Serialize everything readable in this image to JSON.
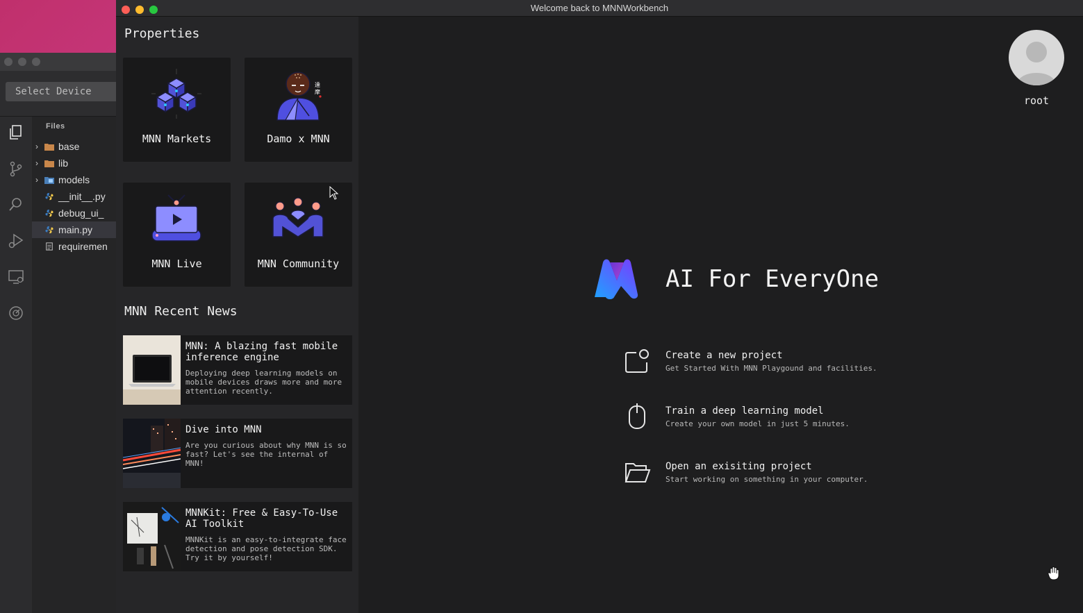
{
  "window": {
    "title": "Welcome back to MNNWorkbench"
  },
  "back_window": {
    "select_device": "Select Device",
    "files_title": "Files",
    "files": [
      {
        "name": "base",
        "type": "folder"
      },
      {
        "name": "lib",
        "type": "folder"
      },
      {
        "name": "models",
        "type": "folder"
      },
      {
        "name": "__init__.py",
        "type": "python"
      },
      {
        "name": "debug_ui_",
        "type": "python"
      },
      {
        "name": "main.py",
        "type": "python",
        "selected": true
      },
      {
        "name": "requiremen",
        "type": "text"
      }
    ]
  },
  "properties": {
    "title": "Properties",
    "cards": [
      {
        "label": "MNN Markets",
        "icon": "cubes-icon"
      },
      {
        "label": "Damo x MNN",
        "icon": "monk-icon"
      },
      {
        "label": "MNN Live",
        "icon": "tv-play-icon"
      },
      {
        "label": "MNN Community",
        "icon": "community-icon"
      }
    ]
  },
  "news": {
    "title": "MNN Recent News",
    "items": [
      {
        "title": "MNN: A blazing fast mobile inference engine",
        "desc": "Deploying deep learning models on mobile devices draws more and more attention recently."
      },
      {
        "title": "Dive into MNN",
        "desc": "Are you curious about why MNN is so fast? Let's see the internal of MNN!"
      },
      {
        "title": "MNNKit: Free & Easy-To-Use AI Toolkit",
        "desc": "MNNKit is an easy-to-integrate face detection and pose detection SDK. Try it by yourself!"
      }
    ]
  },
  "user": {
    "name": "root"
  },
  "hero": {
    "tagline": "AI For EveryOne"
  },
  "actions": [
    {
      "title": "Create a new project",
      "subtitle": "Get Started With MNN Playgound and facilities."
    },
    {
      "title": "Train a deep learning model",
      "subtitle": "Create your own model in just 5 minutes."
    },
    {
      "title": "Open an exisiting project",
      "subtitle": "Start working on something in your computer."
    }
  ],
  "colors": {
    "accent_purple": "#6a5ce6",
    "logo_gradient_start": "#1ea3ff",
    "logo_gradient_end": "#7a3bff",
    "traffic_red": "#fe5f57",
    "traffic_yellow": "#febc2e",
    "traffic_green": "#28c840"
  }
}
